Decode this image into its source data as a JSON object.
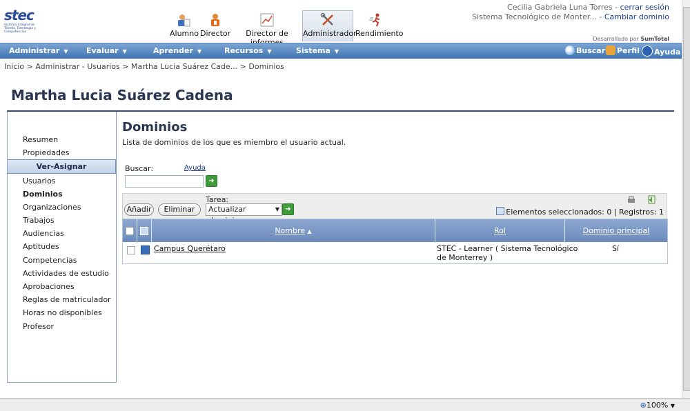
{
  "logo": {
    "text": "stec",
    "tagline": "Sistema Integral de Talento, Estrategia y Competencias"
  },
  "roles": [
    {
      "label": "Alumno",
      "icon": "student-icon"
    },
    {
      "label": "Director",
      "icon": "director-icon"
    },
    {
      "label": "Director de informes",
      "icon": "report-chart-icon"
    },
    {
      "label": "Administrador",
      "icon": "tools-icon"
    },
    {
      "label": "Rendimiento",
      "icon": "runner-icon"
    }
  ],
  "user": {
    "name": "Cecilia Gabriela Luna Torres",
    "logout": "cerrar sesión",
    "domain": "Sistema Tecnológico de Monter...",
    "change_domain": "Cambiar dominio",
    "separator": " - "
  },
  "developed_by": {
    "prefix": "Desarrollado por ",
    "brand": "SumTotal"
  },
  "nav": {
    "items": [
      "Administrar",
      "Evaluar",
      "Aprender",
      "Recursos",
      "Sistema"
    ],
    "caret": "▼",
    "search": "Buscar",
    "profile": "Perfil",
    "help": "Ayuda"
  },
  "breadcrumb": "Inicio > Administrar - Usuarios > Martha Lucia Suárez Cade... > Dominios",
  "page_title": "Martha Lucia Suárez Cadena",
  "sidebar": {
    "top_links": [
      "Resumen",
      "Propiedades"
    ],
    "section": "Ver-Asignar",
    "links": [
      "Usuarios",
      "Dominios",
      "Organizaciones",
      "Trabajos",
      "Audiencias",
      "Aptitudes",
      "Competencias",
      "Actividades de estudio",
      "Aprobaciones",
      "Reglas de matriculador",
      "Horas no disponibles",
      "Profesor"
    ],
    "active": "Dominios"
  },
  "content": {
    "title": "Dominios",
    "description": "Lista de dominios de los que es miembro el usuario actual.",
    "search_label": "Buscar:",
    "help_link": "Ayuda",
    "search_value": ""
  },
  "toolbar": {
    "add": "Añadir",
    "remove": "Eliminar",
    "task_label": "Tarea:",
    "task_value": "Actualizar dominios",
    "status": "Elementos seleccionados: 0 | Registros: 1"
  },
  "table": {
    "columns": [
      "Nombre",
      "Rol",
      "Dominio principal"
    ],
    "sort_indicator": "▲",
    "rows": [
      {
        "name": "Campus Querétaro",
        "role_line1": "STEC - Learner ( Sistema Tecnológico",
        "role_line2": "de Monterrey )",
        "primary": "Sí"
      }
    ]
  },
  "status_bar": {
    "zoom": "100%"
  },
  "colors": {
    "nav_top": "#7ea6d2",
    "nav_bottom": "#3e73b3",
    "title": "#2b3752",
    "header_row": "#7a97c6",
    "go_button": "#3f9a3b"
  }
}
